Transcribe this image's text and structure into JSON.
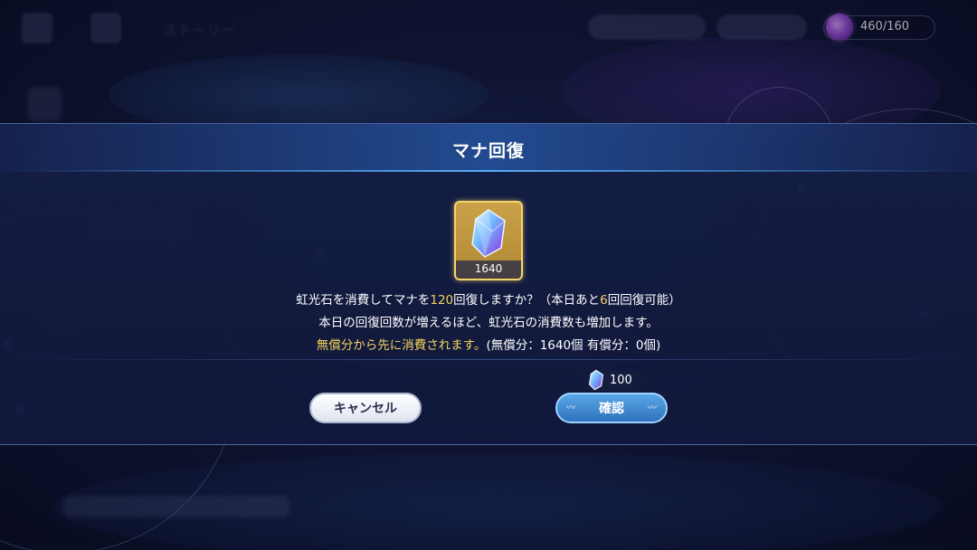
{
  "hud": {
    "mana_value": "460/160",
    "mana_icon": "mana-orb-icon"
  },
  "background": {
    "story_label": "ストーリー"
  },
  "dialog": {
    "title": "マナ回復",
    "item": {
      "name_icon": "rainbow-crystal-icon",
      "count": "1640"
    },
    "message": {
      "line1_a": "虹光石を消費してマナを",
      "line1_amount": "120",
      "line1_b": "回復しますか？（本日あと",
      "line1_remaining": "6",
      "line1_c": "回回復可能）",
      "line2": "本日の回復回数が増えるほど、虹光石の消費数も増加します。",
      "line3_highlight": "無償分から先に消費されます。",
      "line3_detail": "(無償分：1640個 有償分：0個)"
    },
    "cost": {
      "icon": "rainbow-crystal-icon",
      "value": "100"
    },
    "buttons": {
      "cancel_label": "キャンセル",
      "confirm_label": "確認"
    }
  },
  "colors": {
    "highlight": "#f4d35e",
    "header_accent": "#5ab4ff",
    "confirm_button": "#3a86d0",
    "card_border": "#f4d46a"
  }
}
